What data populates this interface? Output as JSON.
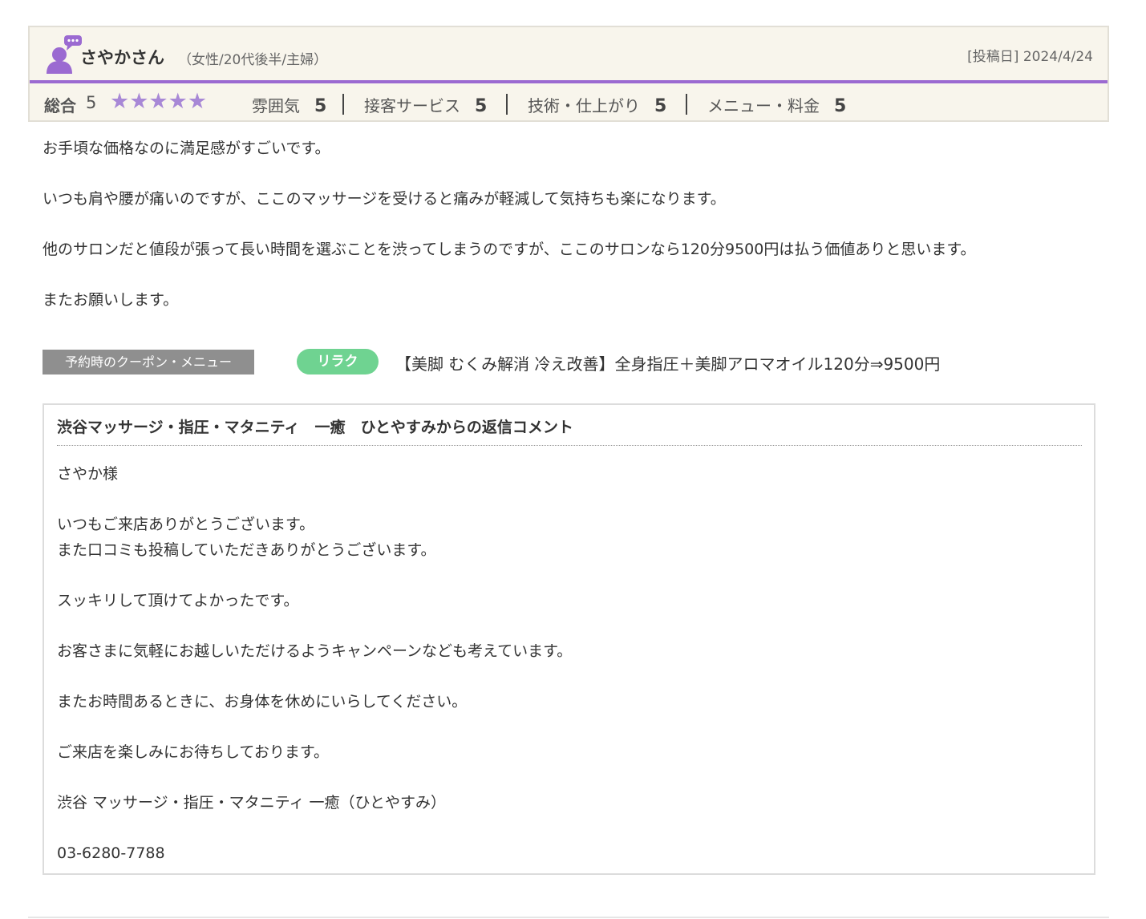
{
  "reviewer": {
    "name": "さやかさん",
    "attributes": "（女性/20代後半/主婦）",
    "post_date": "[投稿日] 2024/4/24",
    "avatar_icon": "user-speech-bubble-icon"
  },
  "ratings": {
    "overall_label": "総合",
    "overall_score": "5",
    "stars": "★★★★★",
    "star_count": 5,
    "items": [
      {
        "label": "雰囲気",
        "value": "5"
      },
      {
        "label": "接客サービス",
        "value": "5"
      },
      {
        "label": "技術・仕上がり",
        "value": "5"
      },
      {
        "label": "メニュー・料金",
        "value": "5"
      }
    ]
  },
  "review": {
    "paragraphs": [
      "お手頃な価格なのに満足感がすごいです。",
      "いつも肩や腰が痛いのですが、ここのマッサージを受けると痛みが軽減して気持ちも楽になります。",
      "他のサロンだと値段が張って長い時間を選ぶことを渋ってしまうのですが、ここのサロンなら120分9500円は払う価値ありと思います。",
      "またお願いします。"
    ]
  },
  "coupon": {
    "label": "予約時のクーポン・メニュー",
    "badge": "リラク",
    "text": "【美脚 むくみ解消 冷え改善】全身指圧＋美脚アロマオイル120分⇒9500円"
  },
  "reply": {
    "title": "渋谷マッサージ・指圧・マタニティ　一癒　ひとやすみからの返信コメント",
    "paragraphs": [
      "さやか様",
      "いつもご来店ありがとうございます。\nまた口コミも投稿していただきありがとうございます。",
      "スッキリして頂けてよかったです。",
      "お客さまに気軽にお越しいただけるようキャンペーンなども考えています。",
      "またお時間あるときに、お身体を休めにいらしてください。",
      "ご来店を楽しみにお待ちしております。",
      "渋谷 マッサージ・指圧・マタニティ 一癒（ひとやすみ）",
      "03-6280-7788"
    ]
  },
  "colors": {
    "accent_purple": "#9b6ad1",
    "star_purple": "#a888d6",
    "header_bg": "#f8f5ec",
    "badge_green": "#6fd391",
    "label_gray": "#8f8f8f"
  }
}
